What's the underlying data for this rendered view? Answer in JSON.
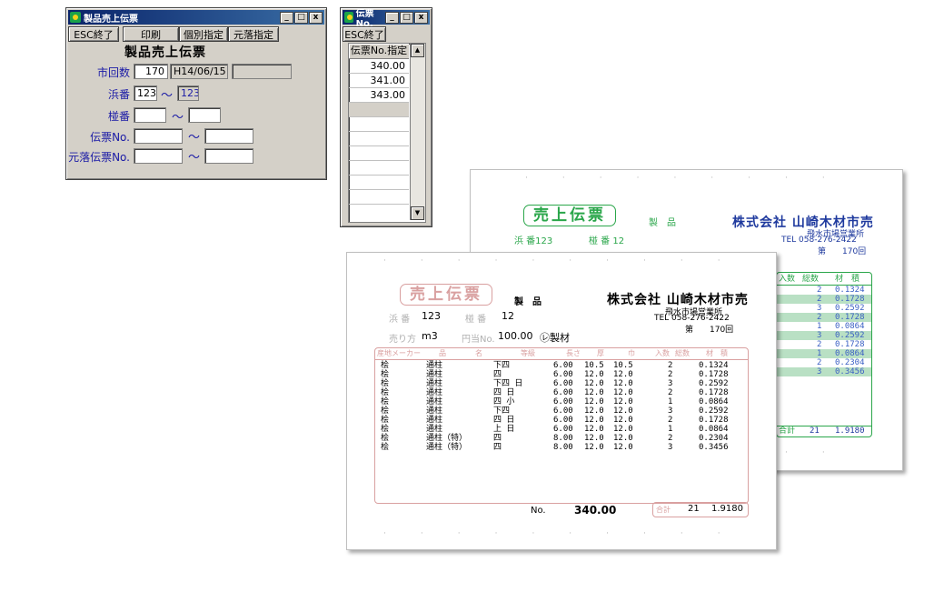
{
  "win1": {
    "title": "製品売上伝票",
    "buttons": {
      "exit": "ESC終了",
      "print": "印刷",
      "individual": "個別指定",
      "source": "元落指定"
    },
    "form_title": "製品売上伝票",
    "fields": {
      "times_label": "市回数",
      "times_value": "170",
      "date_value": "H14/06/15",
      "extra_value": "",
      "hama_label": "浜番",
      "hama_from": "123",
      "hama_to": "123",
      "tsubo_label": "椪番",
      "tsubo_from": "",
      "tsubo_to": "",
      "slip_label": "伝票No.",
      "slip_from": "",
      "slip_to": "",
      "source_label": "元落伝票No.",
      "source_from": "",
      "source_to": "",
      "tilde": "〜"
    }
  },
  "win2": {
    "title": "伝票No.",
    "exit": "ESC終了",
    "header": "伝票No.指定",
    "rows": [
      "340.00",
      "341.00",
      "343.00"
    ]
  },
  "titlebar_buttons": {
    "min": "_",
    "max": "□",
    "close": "x"
  },
  "colors": {
    "title_bar": "#0a246a",
    "label": "#1a1aa6",
    "stamp_red": "#d9a0a0",
    "stamp_green": "#2aa64a",
    "company_blue": "#1f3a9e"
  },
  "back_slip": {
    "stamp": "売上伝票",
    "product": "製　品",
    "company": "株式会社 山崎木材市売",
    "branch": "飛水市場営業所",
    "tel": "TEL 058-276-2422",
    "times": "第　　170回",
    "hama": "浜 番123",
    "tsubo": "椪 番 12",
    "headers": [
      "入数",
      "総数",
      "材　積"
    ],
    "rows": [
      [
        "2",
        "0.1324"
      ],
      [
        "2",
        "0.1728"
      ],
      [
        "3",
        "0.2592"
      ],
      [
        "2",
        "0.1728"
      ],
      [
        "1",
        "0.0864"
      ],
      [
        "3",
        "0.2592"
      ],
      [
        "2",
        "0.1728"
      ],
      [
        "1",
        "0.0864"
      ],
      [
        "2",
        "0.2304"
      ],
      [
        "3",
        "0.3456"
      ]
    ],
    "total_label": "合計",
    "total_count": "21",
    "total_volume": "1.9180"
  },
  "front_slip": {
    "stamp": "売上伝票",
    "product": "製　品",
    "company": "株式会社 山崎木材市売",
    "branch": "飛水市場営業所",
    "tel": "TEL 058-276-2422",
    "times": "第　　170回",
    "hama_label": "浜 番",
    "hama_value": "123",
    "tsubo_label": "椪 番",
    "tsubo_value": "12",
    "unit_label": "売り方",
    "unit_value": "m3",
    "price_label": "円当No.",
    "price_value": "100.00",
    "maker": "㋹製材",
    "headers": [
      "産地メーカー",
      "品",
      "名",
      "等級",
      "長さ",
      "厚",
      "巾",
      "入数",
      "総数",
      "材　積"
    ],
    "rows": [
      [
        "桧",
        "通柱",
        "下四",
        "6.00",
        "10.5",
        "10.5",
        "2",
        "0.1324"
      ],
      [
        "桧",
        "通柱",
        "四",
        "6.00",
        "12.0",
        "12.0",
        "2",
        "0.1728"
      ],
      [
        "桧",
        "通柱",
        "下四 日",
        "6.00",
        "12.0",
        "12.0",
        "3",
        "0.2592"
      ],
      [
        "桧",
        "通柱",
        "四 日",
        "6.00",
        "12.0",
        "12.0",
        "2",
        "0.1728"
      ],
      [
        "桧",
        "通柱",
        "四 小",
        "6.00",
        "12.0",
        "12.0",
        "1",
        "0.0864"
      ],
      [
        "桧",
        "通柱",
        "下四",
        "6.00",
        "12.0",
        "12.0",
        "3",
        "0.2592"
      ],
      [
        "桧",
        "通柱",
        "四 日",
        "6.00",
        "12.0",
        "12.0",
        "2",
        "0.1728"
      ],
      [
        "桧",
        "通柱",
        "上 日",
        "6.00",
        "12.0",
        "12.0",
        "1",
        "0.0864"
      ],
      [
        "桧",
        "通柱（特）",
        "四",
        "8.00",
        "12.0",
        "12.0",
        "2",
        "0.2304"
      ],
      [
        "桧",
        "通柱（特）",
        "四",
        "8.00",
        "12.0",
        "12.0",
        "3",
        "0.3456"
      ]
    ],
    "no_label": "No.",
    "no_value": "340.00",
    "total_label": "合計",
    "total_count": "21",
    "total_volume": "1.9180"
  }
}
